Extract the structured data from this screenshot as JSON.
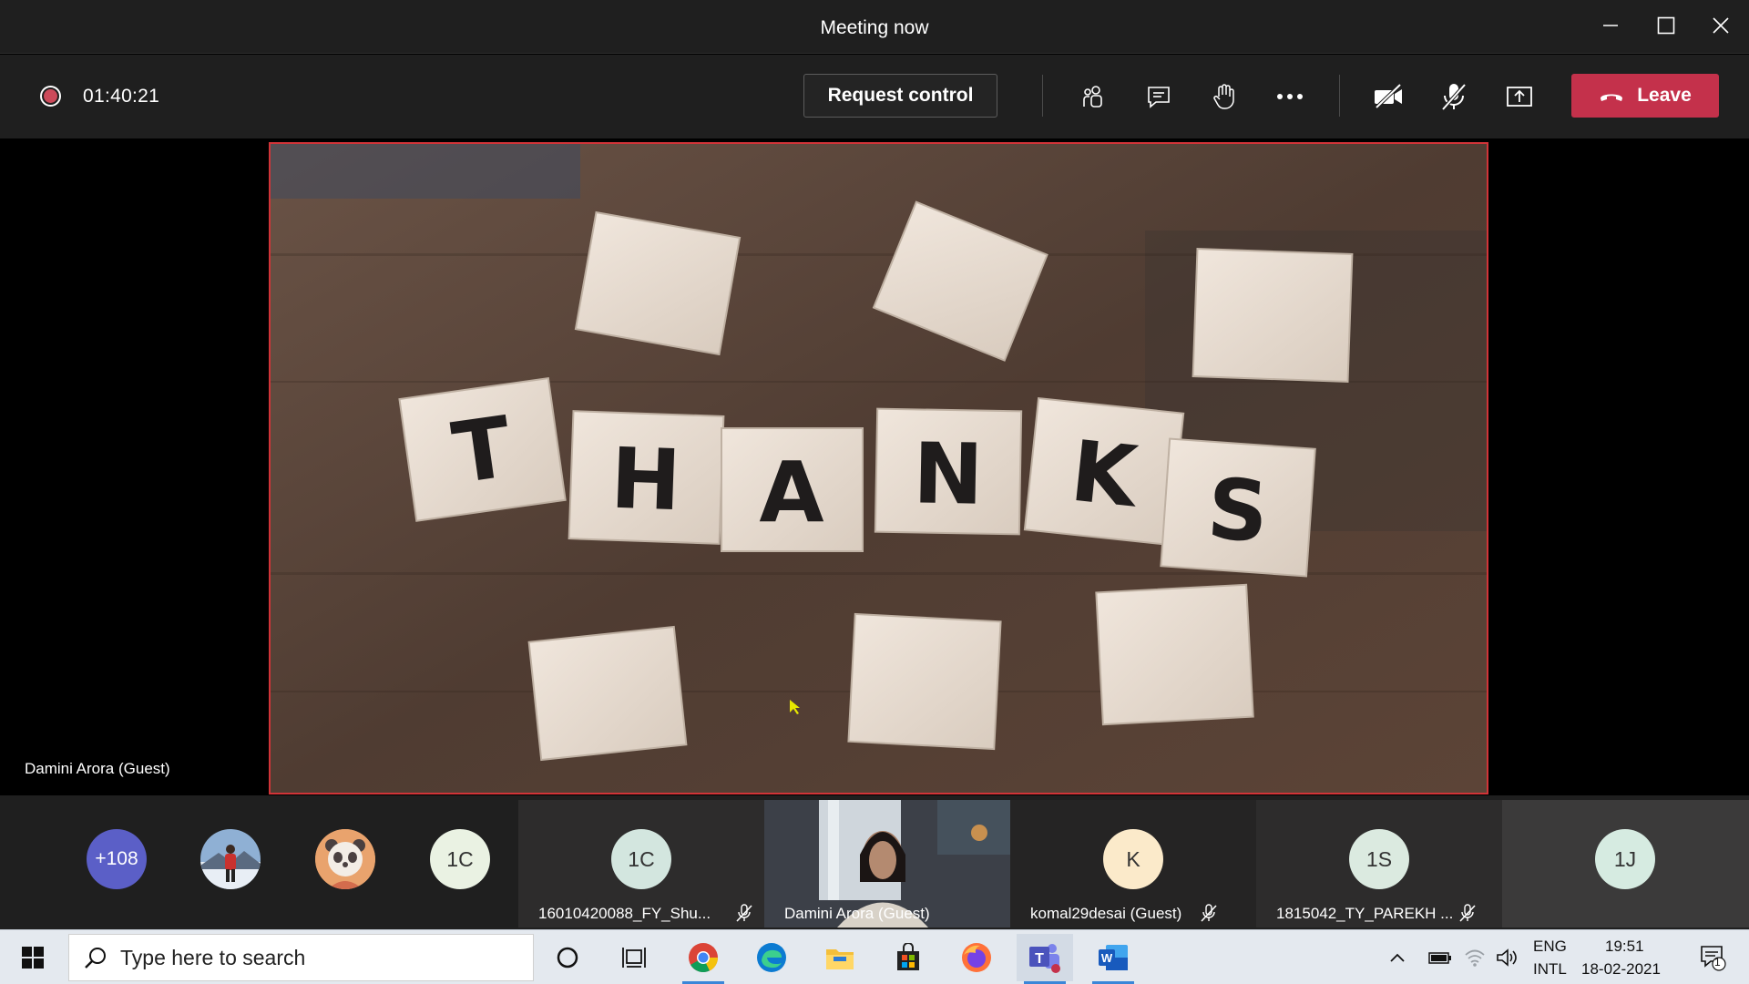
{
  "window": {
    "title": "Meeting now"
  },
  "controls": {
    "timer": "01:40:21",
    "request_control_label": "Request control",
    "leave_label": "Leave",
    "recording_color": "#cc4a5a",
    "leave_color": "#c4314b"
  },
  "main": {
    "presenter_label": "Damini Arora (Guest)",
    "shared_content_text": "THANKS",
    "shared_border_color": "#d13438"
  },
  "gallery": {
    "overflow_count": "+108",
    "tiles": [
      {
        "initials": "1C",
        "name": "16010420088_FY_Shu...",
        "muted": true
      },
      {
        "initials": "",
        "name": "Damini Arora (Guest)",
        "muted": false
      },
      {
        "initials": "K",
        "name": "komal29desai (Guest)",
        "muted": true
      },
      {
        "initials": "1S",
        "name": "1815042_TY_PAREKH ...",
        "muted": true
      },
      {
        "initials": "1J",
        "name": "",
        "muted": false
      }
    ],
    "small_avatars": [
      {
        "initials": "",
        "icon": "person-photo-icon"
      },
      {
        "initials": "",
        "icon": "panda-avatar-icon"
      },
      {
        "initials": "1C",
        "icon": ""
      }
    ]
  },
  "taskbar": {
    "search_placeholder": "Type here to search",
    "language_top": "ENG",
    "language_bottom": "INTL",
    "time": "19:51",
    "date": "18-02-2021",
    "notification_count": "1"
  }
}
